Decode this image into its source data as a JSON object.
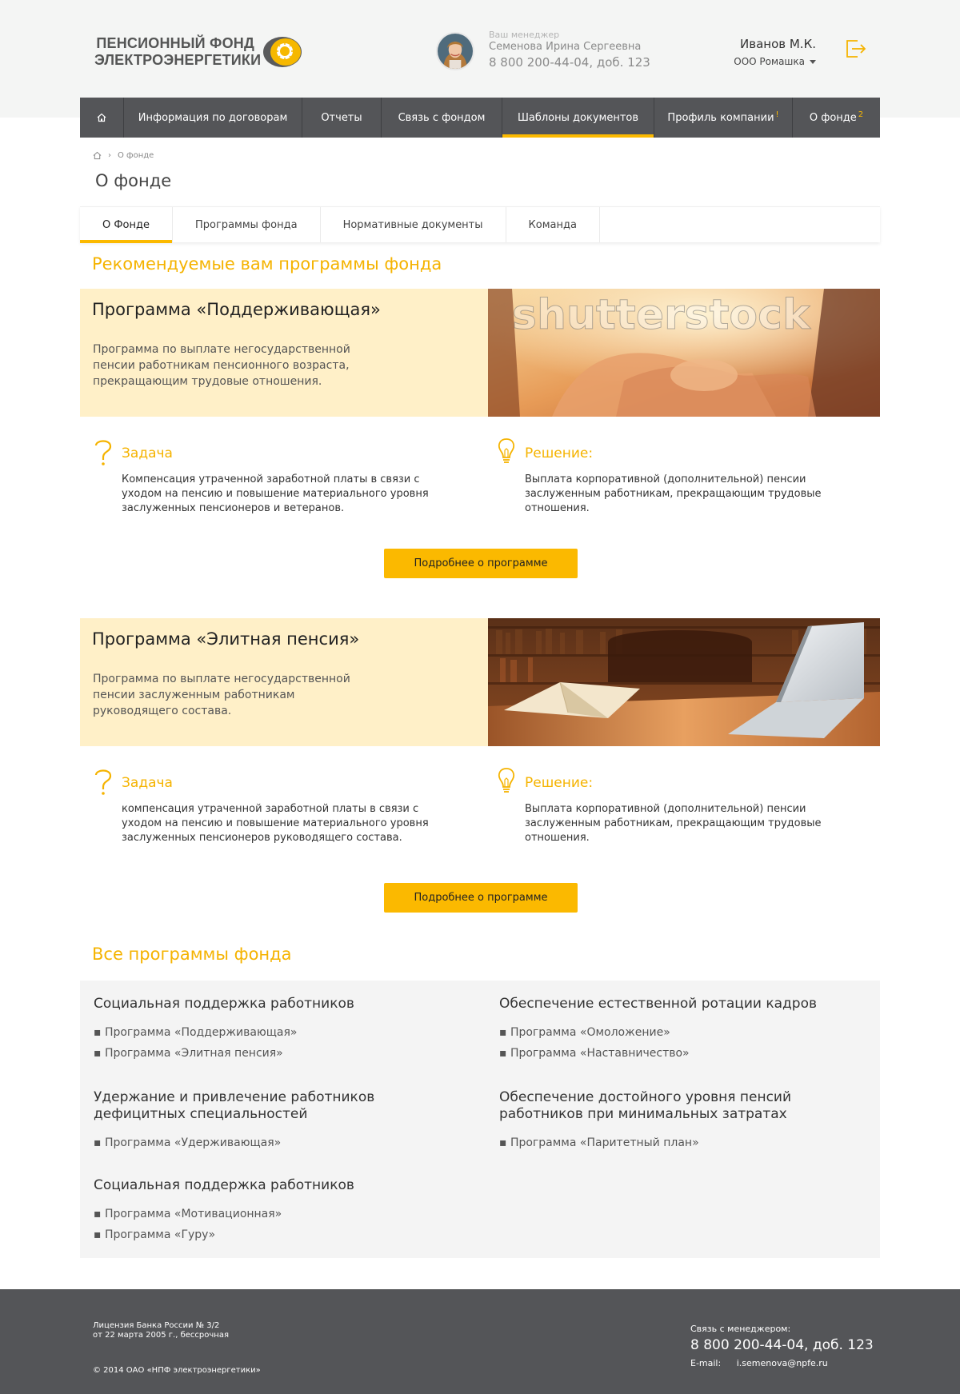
{
  "colors": {
    "accent": "#fbb900",
    "nav_bg": "#545558",
    "card_bg": "#fff0c8",
    "section_title": "#f5b300"
  },
  "logo": {
    "line1": "ПЕНСИОННЫЙ ФОНД",
    "line2": "ЭЛЕКТРОЭНЕРГЕТИКИ"
  },
  "manager": {
    "caption": "Ваш менеджер",
    "name": "Семенова Ирина Сергеевна",
    "phone": "8 800 200-44-04, доб. 123"
  },
  "user": {
    "name": "Иванов М.К.",
    "company": "ООО Ромашка"
  },
  "nav": {
    "items": [
      {
        "label": "",
        "icon": "home-icon"
      },
      {
        "label": "Информация по договорам"
      },
      {
        "label": "Отчеты"
      },
      {
        "label": "Связь с фондом"
      },
      {
        "label": "Шаблоны документов",
        "active": true
      },
      {
        "label": "Профиль компании",
        "badge": "!"
      },
      {
        "label": "О фонде",
        "badge": "2"
      }
    ]
  },
  "breadcrumb": {
    "current": "О фонде"
  },
  "page": {
    "title": "О фонде"
  },
  "subtabs": [
    "О Фонде",
    "Программы фонда",
    "Нормативные документы",
    "Команда"
  ],
  "recommended": {
    "title": "Рекомендуемые вам программы фонда",
    "programs": [
      {
        "title": "Программа «Поддерживающая»",
        "desc": "Программа по выплате негосударственной пенсии работникам пенсионного возраста, прекращающим трудовые отношения.",
        "task_title": "Задача",
        "task_text": "Компенсация утраченной заработной платы в связи с уходом на пенсию и повышение материального уровня заслуженных пенсионеров и ветеранов.",
        "solution_title": "Решение:",
        "solution_text": "Выплата корпоративной (дополнительной) пенсии заслуженным работникам, прекращающим трудовые отношения.",
        "button": "Подробнее о программе",
        "image_watermark": "shutterstock"
      },
      {
        "title": "Программа «Элитная пенсия»",
        "desc": "Программа по выплате негосударственной пенсии заслуженным работникам руководящего состава.",
        "task_title": "Задача",
        "task_text": "компенсация утраченной заработной платы в связи с уходом на пенсию и повышение материального уровня заслуженных пенсионеров руководящего состава.",
        "solution_title": "Решение:",
        "solution_text": "Выплата корпоративной (дополнительной) пенсии заслуженным работникам, прекращающим трудовые отношения.",
        "button": "Подробнее о программе"
      }
    ]
  },
  "all_programs": {
    "title": "Все программы фонда",
    "groups": [
      {
        "title": "Социальная поддержка работников",
        "items": [
          "▪ Программа «Поддерживающая»",
          "▪ Программа «Элитная пенсия»"
        ]
      },
      {
        "title": "Обеспечение естественной ротации кадров",
        "items": [
          "▪ Программа «Омоложение»",
          "▪ Программа «Наставничество»"
        ]
      },
      {
        "title": "Удержание и привлечение работников дефицитных специальностей",
        "items": [
          "▪ Программа «Удерживающая»"
        ]
      },
      {
        "title": "Обеспечение достойного уровня пенсий работников при минимальных затратах",
        "items": [
          "▪ Программа «Паритетный план»"
        ]
      },
      {
        "title": "Социальная поддержка работников",
        "items": [
          "▪ Программа «Мотивационная»",
          "▪ Программа «Гуру»"
        ]
      }
    ]
  },
  "footer": {
    "license_line1": "Лицензия Банка России № 3/2",
    "license_line2": "от 22 марта 2005 г., бессрочная",
    "copyright": "© 2014 ОАО «НПФ электроэнергетики»",
    "contact_caption": "Связь с менеджером:",
    "contact_phone": "8 800 200-44-04, доб. 123",
    "email_label": "E-mail:",
    "email": "i.semenova@npfe.ru"
  }
}
